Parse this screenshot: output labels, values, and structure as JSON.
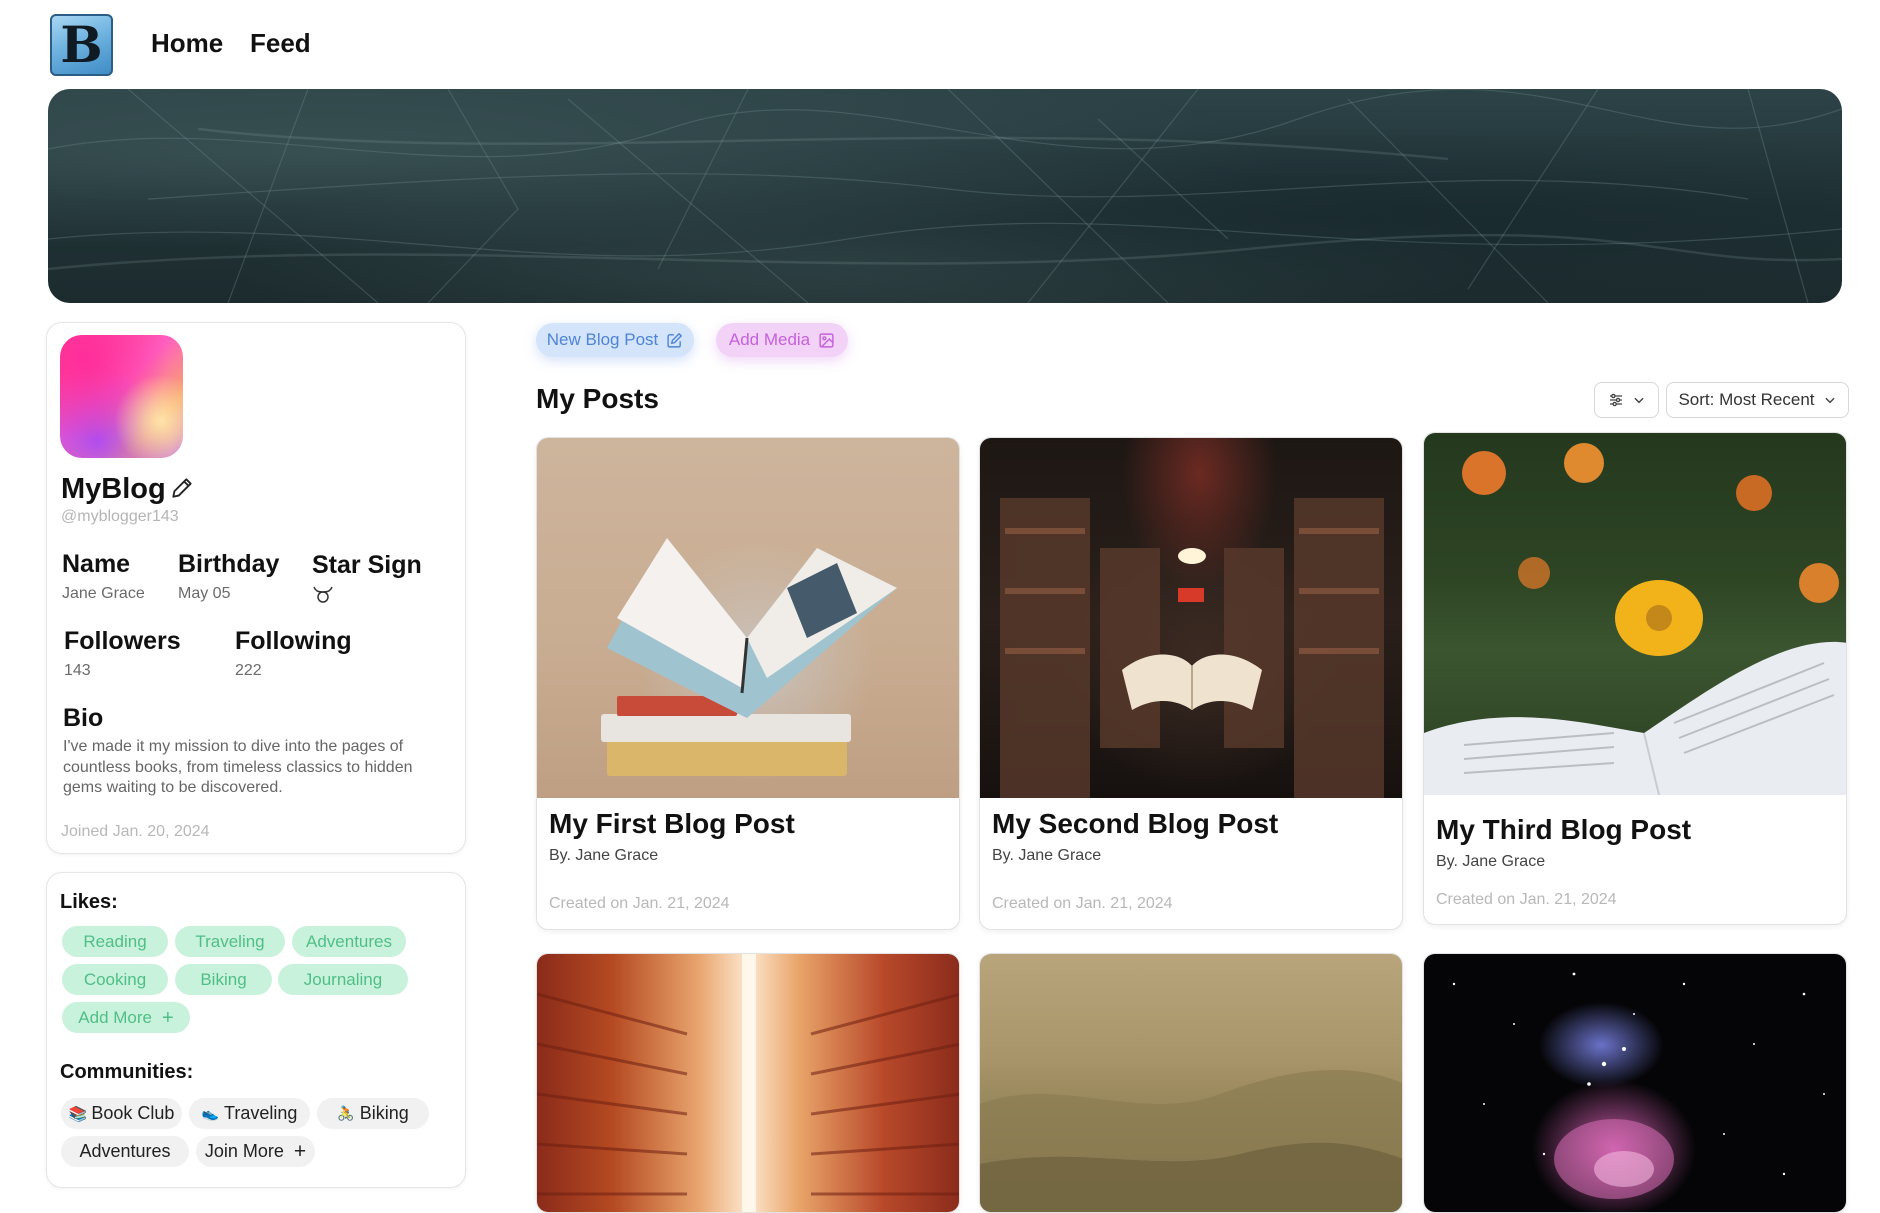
{
  "nav": {
    "logo_letter": "B",
    "links": [
      "Home",
      "Feed"
    ]
  },
  "profile": {
    "name": "MyBlog",
    "handle": "@myblogger143",
    "fields": {
      "name_label": "Name",
      "name_value": "Jane Grace",
      "birthday_label": "Birthday",
      "birthday_value": "May 05",
      "starsign_label": "Star Sign",
      "starsign_icon": "taurus-icon",
      "followers_label": "Followers",
      "followers_value": "143",
      "following_label": "Following",
      "following_value": "222"
    },
    "bio_label": "Bio",
    "bio": "I've made it my mission to dive into the pages of countless books, from timeless classics to hidden gems waiting to be discovered.",
    "joined": "Joined Jan. 20, 2024"
  },
  "likes": {
    "label": "Likes:",
    "items": [
      "Reading",
      "Traveling",
      "Adventures",
      "Cooking",
      "Biking",
      "Journaling"
    ],
    "add_more": "Add More"
  },
  "communities": {
    "label": "Communities:",
    "items": [
      "Book Club",
      "Traveling",
      "Biking",
      "Adventures"
    ],
    "join_more": "Join More"
  },
  "actions": {
    "new_post": "New Blog Post",
    "add_media": "Add Media"
  },
  "posts_section": {
    "title": "My Posts",
    "sort": "Sort: Most Recent"
  },
  "posts": [
    {
      "title": "My First Blog Post",
      "author": "By. Jane Grace",
      "created": "Created on Jan. 21, 2024"
    },
    {
      "title": "My Second Blog Post",
      "author": "By. Jane Grace",
      "created": "Created on Jan. 21, 2024"
    },
    {
      "title": "My Third Blog Post",
      "author": "By. Jane Grace",
      "created": "Created on Jan. 21, 2024"
    }
  ],
  "colors": {
    "accent_blue": "#d3e4fb",
    "accent_pink": "#f3d2f7",
    "like_chip": "#c9f2dc",
    "banner": "#263a3e"
  }
}
